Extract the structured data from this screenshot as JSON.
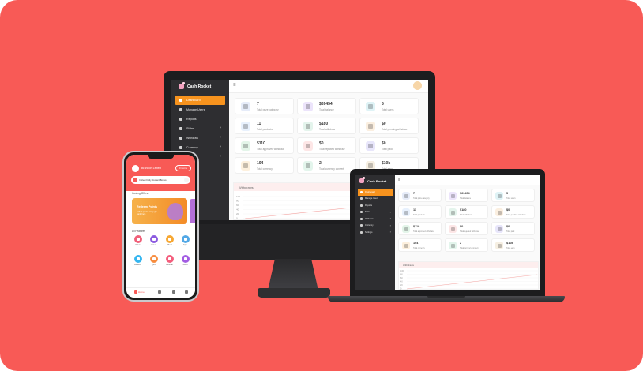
{
  "brand": "Cash Rocket",
  "colors": {
    "background": "#f85a56",
    "accent": "#f7931e",
    "sidebar": "#2e2e31"
  },
  "sidebar": {
    "items": [
      {
        "label": "Dashboard",
        "icon": "home-icon",
        "active": true
      },
      {
        "label": "Manage Users",
        "icon": "cloud-icon"
      },
      {
        "label": "Reports",
        "icon": "circle-icon"
      },
      {
        "label": "Slider",
        "icon": "image-icon"
      },
      {
        "label": "Withdraw",
        "icon": "list-icon"
      },
      {
        "label": "Currency",
        "icon": "gear-icon"
      },
      {
        "label": "Settings",
        "icon": "gear-icon"
      }
    ]
  },
  "stats": [
    {
      "value": "7",
      "label": "Total prize category",
      "icon": "tag-icon",
      "color": "#e6ecf9"
    },
    {
      "value": "$69454",
      "label": "Total balance",
      "icon": "balance-icon",
      "color": "#ece4fb"
    },
    {
      "value": "5",
      "label": "Total users",
      "icon": "users-icon",
      "color": "#dff3f6"
    },
    {
      "value": "11",
      "label": "Total products",
      "icon": "trophy-icon",
      "color": "#e8f1fd"
    },
    {
      "value": "$180",
      "label": "Total withdraw",
      "icon": "money-icon",
      "color": "#e4f4ec"
    },
    {
      "value": "$0",
      "label": "Total pending withdraw",
      "icon": "hourglass-icon",
      "color": "#fbefe0"
    },
    {
      "value": "$110",
      "label": "Total approved withdraw",
      "icon": "check-icon",
      "color": "#e3f5e9"
    },
    {
      "value": "$0",
      "label": "Total rejected withdraw",
      "icon": "reject-icon",
      "color": "#fde6e6"
    },
    {
      "value": "$0",
      "label": "Total paid",
      "icon": "paid-icon",
      "color": "#e8e6fb"
    },
    {
      "value": "104",
      "label": "Total currency",
      "icon": "coin-icon",
      "color": "#fdf0dd"
    },
    {
      "value": "2",
      "label": "Total currency convert",
      "icon": "convert-icon",
      "color": "#e3f5ec"
    },
    {
      "value": "$10k",
      "label": "Total earn",
      "icon": "medal-icon",
      "color": "#f6efe2"
    }
  ],
  "chart": {
    "title": "Withdraws",
    "ticks": [
      "100",
      "80",
      "60",
      "40",
      "20",
      "0"
    ]
  },
  "phone": {
    "user_name": "Brandon Lebert",
    "points": "0 Coins",
    "banner_bar": "Collect Daily Reward Bonus",
    "section_offers": "Hosting Offers",
    "banner_title": "Redeem Points",
    "banner_sub": "Collect points to buy gift cards here",
    "section_features": "All Features",
    "features": [
      {
        "label": "Offers",
        "color": "#f0617a"
      },
      {
        "label": "Videos",
        "color": "#8c5be0"
      },
      {
        "label": "Wheel",
        "color": "#f7a834"
      },
      {
        "label": "Spin",
        "color": "#52a8e6"
      },
      {
        "label": "Redeem",
        "color": "#35b6f0"
      },
      {
        "label": "Quiz",
        "color": "#f78c3e"
      },
      {
        "label": "Referral",
        "color": "#f45e7d"
      },
      {
        "label": "Share",
        "color": "#a35de3"
      }
    ],
    "tabs": {
      "home": "Home",
      "chat": "",
      "wallet": "",
      "profile": ""
    }
  }
}
